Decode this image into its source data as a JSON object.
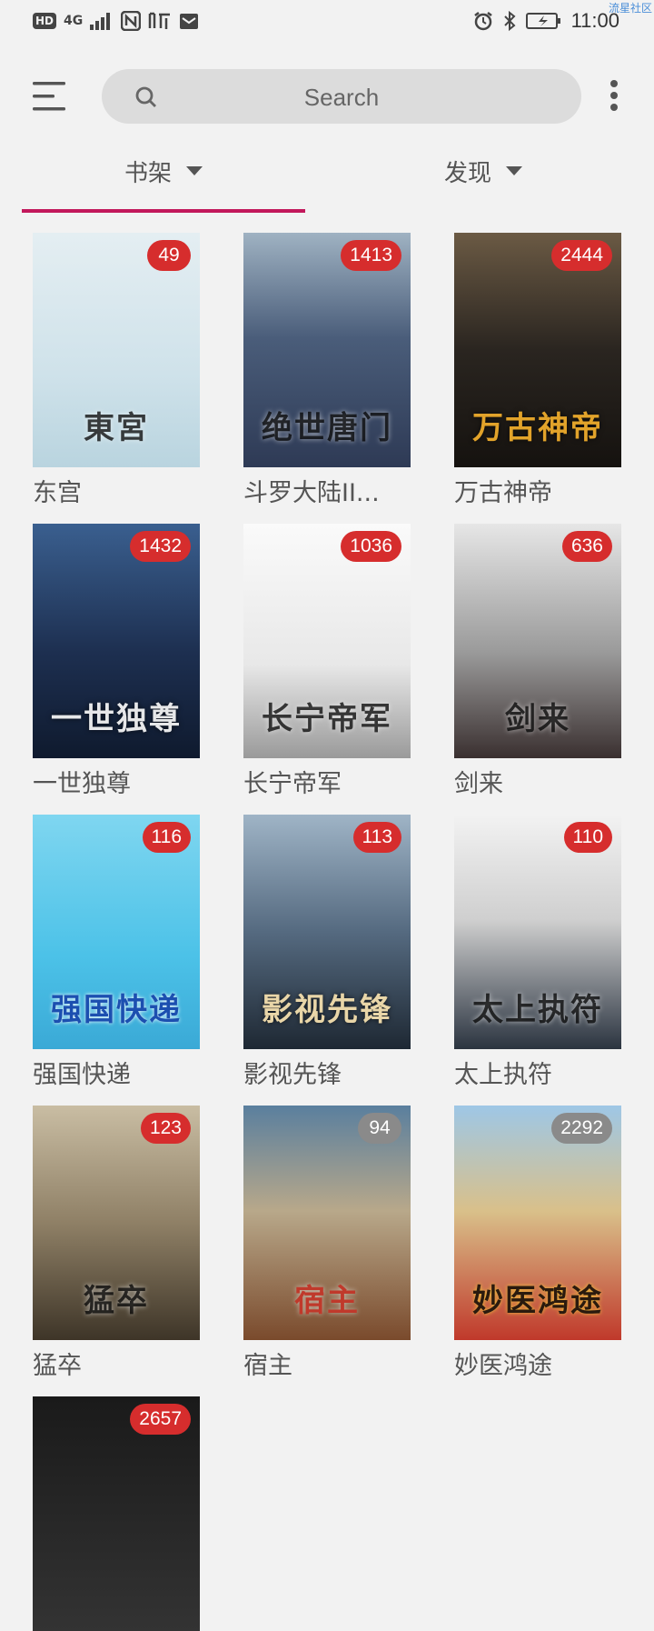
{
  "status_bar": {
    "hd": "HD",
    "network": "4G",
    "time": "11:00",
    "watermark": "流星社区"
  },
  "toolbar": {
    "search_placeholder": "Search"
  },
  "tabs": [
    {
      "label": "书架",
      "active": true
    },
    {
      "label": "发现",
      "active": false
    }
  ],
  "accent_color": "#c2185b",
  "badge_color": "#d62d2d",
  "books": [
    {
      "title": "东宫",
      "count": "49",
      "cover_text": "東宮",
      "grey": false
    },
    {
      "title": "斗罗大陆II...",
      "count": "1413",
      "cover_text": "绝世唐门",
      "grey": false
    },
    {
      "title": "万古神帝",
      "count": "2444",
      "cover_text": "万古神帝",
      "grey": false
    },
    {
      "title": "一世独尊",
      "count": "1432",
      "cover_text": "一世独尊",
      "grey": false
    },
    {
      "title": "长宁帝军",
      "count": "1036",
      "cover_text": "长宁帝军",
      "grey": false
    },
    {
      "title": "剑来",
      "count": "636",
      "cover_text": "剑来",
      "grey": false
    },
    {
      "title": "强国快递",
      "count": "116",
      "cover_text": "强国快递",
      "grey": false
    },
    {
      "title": "影视先锋",
      "count": "113",
      "cover_text": "影视先锋",
      "grey": false
    },
    {
      "title": "太上执符",
      "count": "110",
      "cover_text": "太上执符",
      "grey": false
    },
    {
      "title": "猛卒",
      "count": "123",
      "cover_text": "猛卒",
      "grey": false
    },
    {
      "title": "宿主",
      "count": "94",
      "cover_text": "宿主",
      "grey": true
    },
    {
      "title": "妙医鸿途",
      "count": "2292",
      "cover_text": "妙医鸿途",
      "grey": true
    },
    {
      "title": "",
      "count": "2657",
      "cover_text": "",
      "grey": false
    }
  ]
}
